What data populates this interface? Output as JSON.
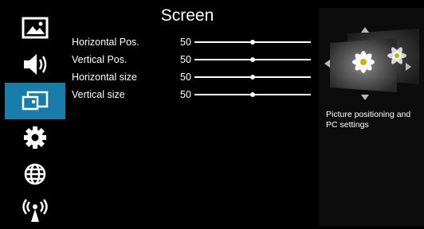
{
  "sidebar": {
    "items": [
      {
        "icon": "picture-icon",
        "active": false
      },
      {
        "icon": "speaker-icon",
        "active": false
      },
      {
        "icon": "screen-icon",
        "active": true
      },
      {
        "icon": "gear-icon",
        "active": false
      },
      {
        "icon": "globe-icon",
        "active": false
      },
      {
        "icon": "broadcast-icon",
        "active": false
      }
    ],
    "active_color": "#1a7ca8"
  },
  "main": {
    "title": "Screen",
    "rows": [
      {
        "label": "Horizontal Pos.",
        "value": "50",
        "level": 0.5
      },
      {
        "label": "Vertical Pos.",
        "value": "50",
        "level": 0.5
      },
      {
        "label": "Horizontal size",
        "value": "50",
        "level": 0.5
      },
      {
        "label": "Vertical size",
        "value": "50",
        "level": 0.5
      }
    ]
  },
  "info": {
    "description": "Picture positioning and PC settings"
  }
}
